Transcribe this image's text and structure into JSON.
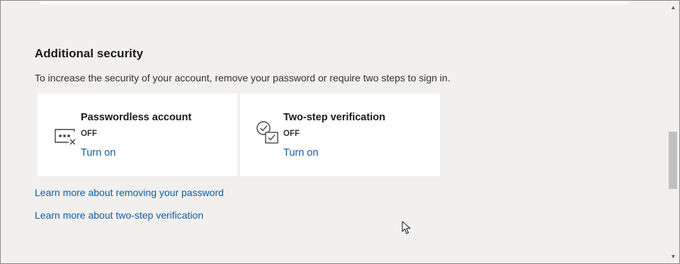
{
  "section": {
    "title": "Additional security",
    "description": "To increase the security of your account, remove your password or require two steps to sign in."
  },
  "cards": [
    {
      "title": "Passwordless account",
      "status": "OFF",
      "action": "Turn on",
      "icon": "passwordless-icon"
    },
    {
      "title": "Two-step verification",
      "status": "OFF",
      "action": "Turn on",
      "icon": "two-step-verification-icon"
    }
  ],
  "links": {
    "remove_password": "Learn more about removing your password",
    "two_step": "Learn more about two-step verification"
  },
  "scrollbar": {
    "up_glyph": "▲",
    "down_glyph": "▼"
  },
  "colors": {
    "background": "#f2f0ef",
    "card": "#ffffff",
    "link": "#0f5ea3",
    "text": "#1b1b1b"
  }
}
